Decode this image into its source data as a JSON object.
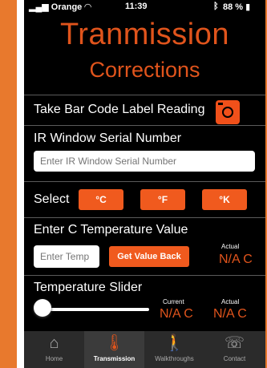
{
  "status_bar": {
    "carrier": "Orange",
    "time": "11:39",
    "battery": "88 %"
  },
  "header": {
    "title": "Tranmission",
    "subtitle": "Corrections"
  },
  "barcode": {
    "label": "Take Bar Code Label Reading",
    "icon": "camera-icon"
  },
  "ir_window": {
    "label": "IR Window Serial Number",
    "placeholder": "Enter IR Window Serial Number"
  },
  "units": {
    "select_label": "Select",
    "options": [
      "°C",
      "°F",
      "°K"
    ]
  },
  "temperature": {
    "label": "Enter C Temperature Value",
    "input_placeholder": "Enter Temp",
    "button_label": "Get Value Back",
    "actual_label": "Actual",
    "actual_value": "N/A  C"
  },
  "slider": {
    "label": "Temperature Slider",
    "current_label": "Current",
    "current_value": "N/A  C",
    "actual_label": "Actual",
    "actual_value": "N/A  C",
    "level": 0
  },
  "tabs": [
    {
      "label": "Home",
      "icon": "home-icon"
    },
    {
      "label": "Transmission",
      "icon": "thermometer-icon",
      "active": true
    },
    {
      "label": "Walkthroughs",
      "icon": "walking-person-icon"
    },
    {
      "label": "Contact",
      "icon": "phone-icon"
    }
  ],
  "colors": {
    "accent": "#f05a1e",
    "frame": "#e8792d",
    "background": "#000000"
  }
}
